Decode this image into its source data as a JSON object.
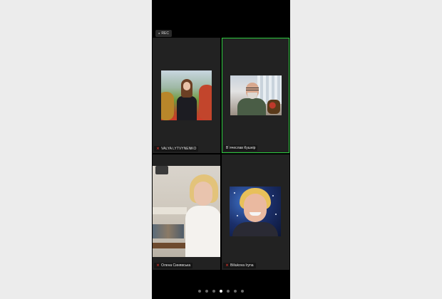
{
  "recording": {
    "icon": "rec-dot-icon",
    "label": "REC"
  },
  "participants": [
    {
      "name": "VALYA LYTVYNENKO",
      "muted": true,
      "active_speaker": false
    },
    {
      "name": "В`ячеслав Кушнір",
      "muted": false,
      "active_speaker": true
    },
    {
      "name": "Олена Синявська",
      "muted": true,
      "active_speaker": false
    },
    {
      "name": "Biliukova Iryna",
      "muted": true,
      "active_speaker": false
    }
  ],
  "pagination": {
    "total": 7,
    "current": 4
  },
  "colors": {
    "active_speaker_border": "#2ecc40",
    "muted_icon": "#ff3b30"
  },
  "icons": {
    "muted": "⨯"
  }
}
